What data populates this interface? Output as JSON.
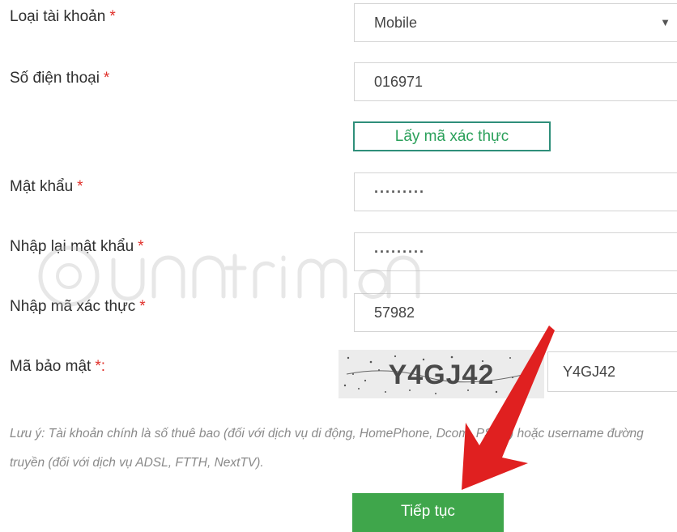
{
  "form": {
    "account_type": {
      "label": "Loại tài khoản",
      "required_mark": "*",
      "value": "Mobile",
      "arrow": "▼"
    },
    "phone": {
      "label": "Số điện thoại",
      "required_mark": "*",
      "value": "016971"
    },
    "otp_button": {
      "label": "Lấy mã xác thực"
    },
    "password": {
      "label": "Mật khẩu",
      "required_mark": "*",
      "value": "·········"
    },
    "password_confirm": {
      "label": "Nhập lại mật khẩu",
      "required_mark": "*",
      "value": "·········"
    },
    "otp_code": {
      "label": "Nhập mã xác thực",
      "required_mark": "*",
      "value": "57982"
    },
    "captcha": {
      "label": "Mã bảo mật",
      "required_mark": "*:",
      "image_text": "Y4GJ42",
      "value": "Y4GJ42"
    },
    "note": "Lưu ý: Tài khoản chính là số thuê bao (đối với dịch vụ di động, HomePhone, Dcom, PSTN) hoặc username đường truyền (đối với dịch vụ ADSL, FTTH, NextTV).",
    "submit_label": "Tiếp tục"
  },
  "colors": {
    "required": "#e0302a",
    "otp_border": "#2f8f7a",
    "otp_text": "#2aa05a",
    "submit_bg": "#3fa64b",
    "arrow": "#e02020"
  }
}
